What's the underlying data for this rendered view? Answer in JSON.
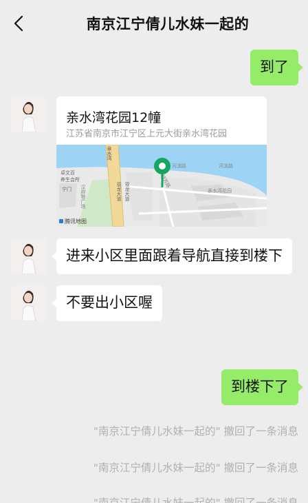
{
  "header": {
    "title": "南京江宁倩儿水妹一起的"
  },
  "messages": {
    "m1": "到了",
    "location": {
      "name": "亲水湾花园12幢",
      "address": "江苏省南京市江宁区上元大街亲水湾花园"
    },
    "m2": "进来小区里面跟着导航直接到楼下",
    "m3": "不要出小区喔",
    "m4": "到楼下了"
  },
  "map": {
    "provider": "腾讯地图",
    "labels": [
      "双龙大道",
      "双龙大道",
      "亲水湾",
      "河滨路",
      "河滨路",
      "亲水湾花园",
      "汉府物广场",
      "宁门",
      "胡苏路",
      "卓文百",
      "养生会所"
    ]
  },
  "recalls": [
    "\"南京江宁倩儿水妹一起的\" 撤回了一条消息",
    "\"南京江宁倩儿水妹一起的\" 撤回了一条消息",
    "\"南京江宁倩儿水妹一起的\" 撤回了一条消息"
  ],
  "colors": {
    "self_bubble": "#95ec69",
    "other_bubble": "#ffffff",
    "background": "#ededed",
    "pin": "#14a561"
  }
}
